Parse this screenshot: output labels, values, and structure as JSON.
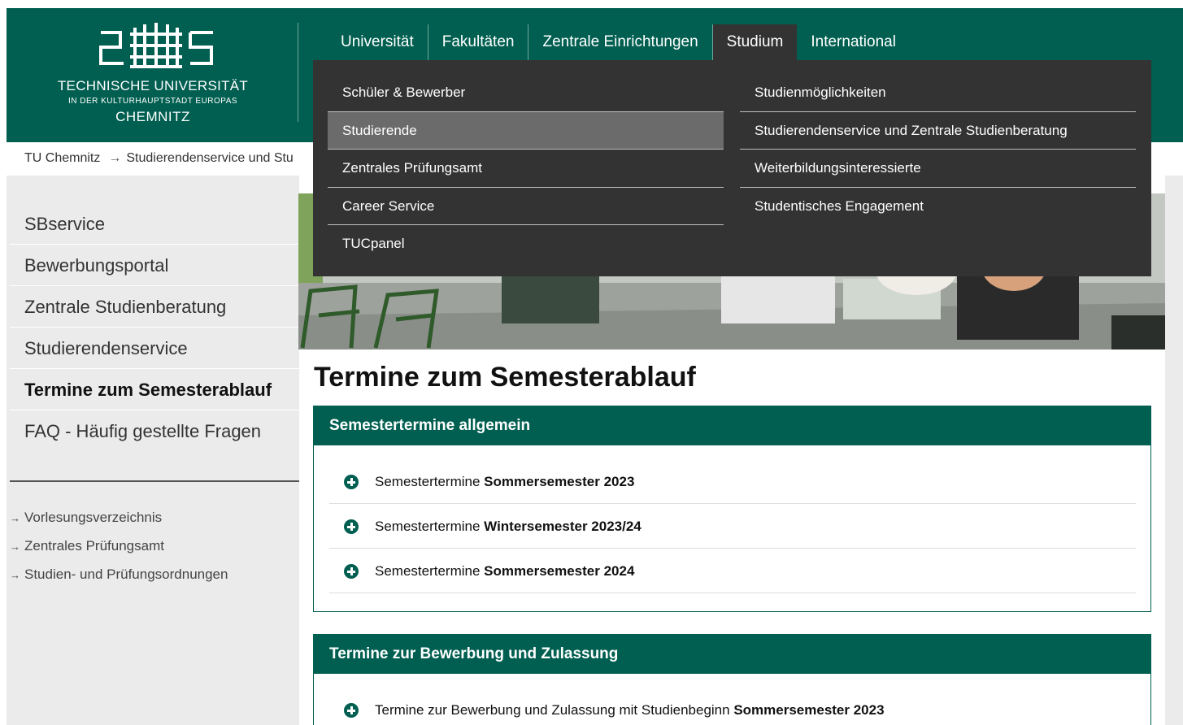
{
  "header": {
    "logo": {
      "line1": "TECHNISCHE UNIVERSITÄT",
      "line2": "IN DER KULTURHAUPTSTADT EUROPAS",
      "line3": "CHEMNITZ"
    },
    "nav_tabs": [
      {
        "label": "Universität",
        "active": false
      },
      {
        "label": "Fakultäten",
        "active": false
      },
      {
        "label": "Zentrale Einrichtungen",
        "active": false
      },
      {
        "label": "Studium",
        "active": true
      },
      {
        "label": "International",
        "active": false
      }
    ]
  },
  "dropdown": {
    "col1": [
      "Schüler & Bewerber",
      "Studierende",
      "Zentrales Prüfungsamt",
      "Career Service",
      "TUCpanel"
    ],
    "col2": [
      "Studienmöglichkeiten",
      "Studierendenservice und Zentrale Studienberatung",
      "Weiterbildungsinteressierte",
      "Studentisches Engagement"
    ],
    "highlighted": "Studierende"
  },
  "breadcrumb": {
    "items": [
      "TU Chemnitz",
      "Studierendenservice und Stu"
    ],
    "separator": "→"
  },
  "sidebar": {
    "items": [
      {
        "label": "SBservice",
        "active": false
      },
      {
        "label": "Bewerbungsportal",
        "active": false
      },
      {
        "label": "Zentrale Studienberatung",
        "active": false
      },
      {
        "label": "Studierendenservice",
        "active": false
      },
      {
        "label": "Termine zum Semesterablauf",
        "active": true
      },
      {
        "label": "FAQ - Häufig gestellte Fragen",
        "active": false
      }
    ],
    "links": [
      "Vorlesungsverzeichnis",
      "Zentrales Prüfungsamt",
      "Studien- und Prüfungsordnungen"
    ],
    "link_arrow": "→"
  },
  "main": {
    "title": "Termine zum Semesterablauf",
    "sections": [
      {
        "heading": "Semestertermine allgemein",
        "rows": [
          {
            "prefix": "Semestertermine ",
            "bold": "Sommersemester 2023"
          },
          {
            "prefix": "Semestertermine ",
            "bold": "Wintersemester 2023/24"
          },
          {
            "prefix": "Semestertermine ",
            "bold": "Sommersemester 2024"
          }
        ]
      },
      {
        "heading": "Termine zur Bewerbung und Zulassung",
        "rows": [
          {
            "prefix": "Termine zur Bewerbung und Zulassung mit Studienbeginn ",
            "bold": "Sommersemester 2023"
          }
        ]
      }
    ]
  },
  "colors": {
    "brand_green": "#005f50",
    "dropdown_bg": "#333333",
    "dropdown_highlight": "#6b6b6b",
    "sidebar_bg": "#ebebeb"
  },
  "icons": {
    "accordion": "plus-circle-icon",
    "logo": "tu-chemnitz-logo-icon"
  }
}
